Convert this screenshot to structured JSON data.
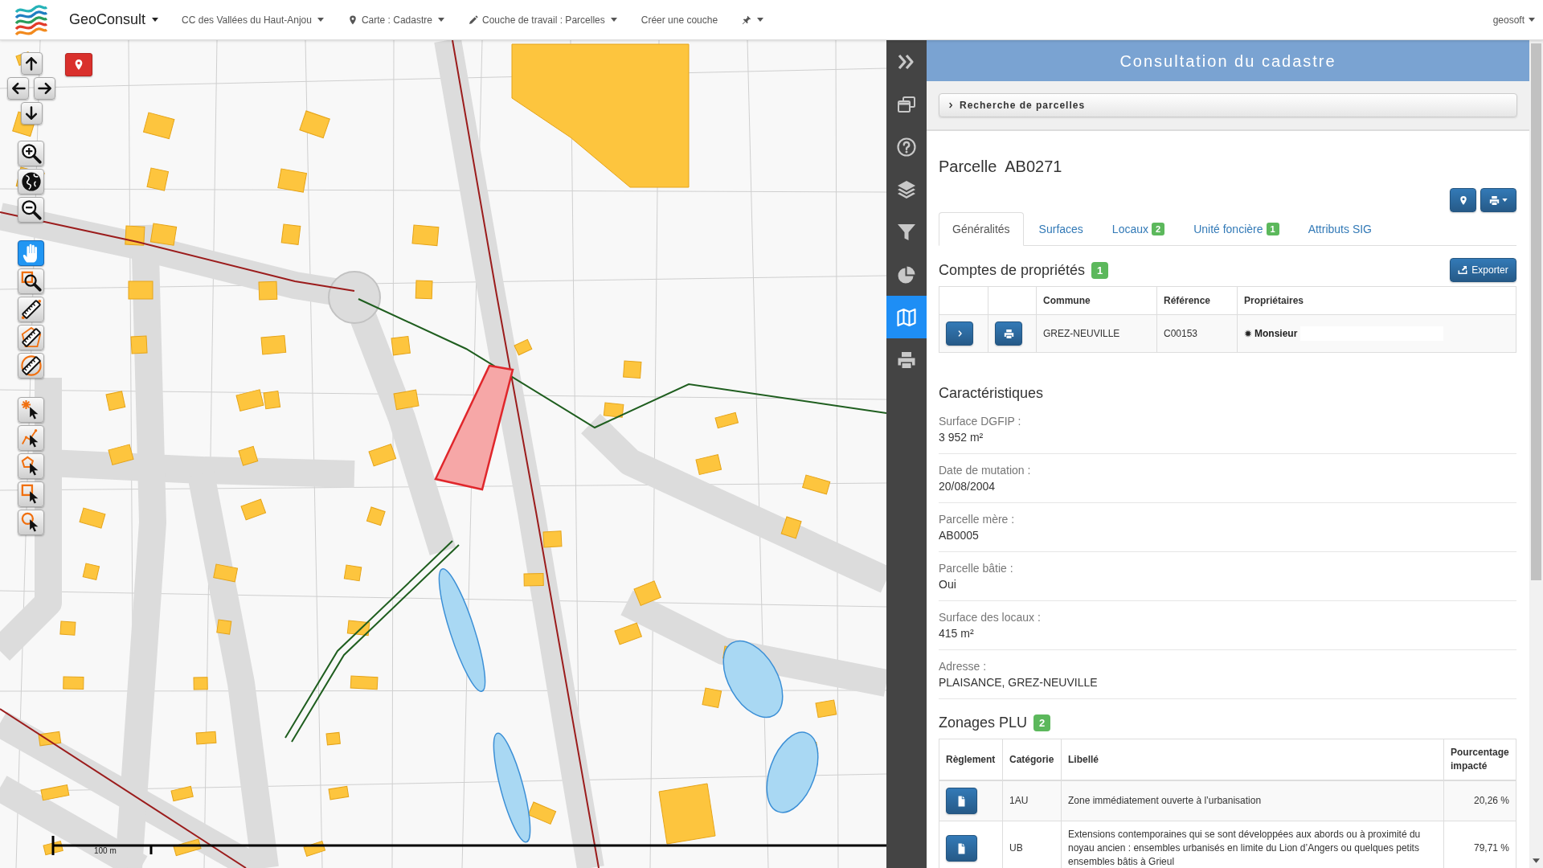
{
  "navbar": {
    "brand": "GeoConsult",
    "menus": [
      {
        "label": "CC des Vallées du Haut-Anjou",
        "kind": "plain",
        "dropdown": true
      },
      {
        "label": "Carte : Cadastre",
        "kind": "map",
        "dropdown": true
      },
      {
        "label": "Couche de travail : Parcelles",
        "kind": "layer",
        "dropdown": true
      },
      {
        "label": "Créer une couche",
        "kind": "plain",
        "dropdown": false
      },
      {
        "kind": "tools",
        "dropdown": true
      }
    ],
    "user": "geosoft"
  },
  "map": {
    "draw_tools": [
      {
        "kind": "pan",
        "selected": true
      },
      {
        "kind": "zoom-box",
        "selected": false
      },
      {
        "kind": "measure-length",
        "selected": false
      },
      {
        "kind": "measure-area",
        "selected": false
      },
      {
        "kind": "measure-radius",
        "selected": false
      }
    ],
    "select_tools": [
      {
        "kind": "point",
        "selected": false
      },
      {
        "kind": "line",
        "selected": false
      },
      {
        "kind": "polygon",
        "selected": false
      },
      {
        "kind": "box",
        "selected": false
      },
      {
        "kind": "circle",
        "selected": false
      }
    ],
    "scale_label": "100 m"
  },
  "sidebar": {
    "items": [
      {
        "kind": "collapse",
        "selected": false
      },
      {
        "kind": "windows",
        "selected": false
      },
      {
        "kind": "help",
        "selected": false
      },
      {
        "kind": "layers",
        "selected": false
      },
      {
        "kind": "filter",
        "selected": false
      },
      {
        "kind": "stats",
        "selected": false
      },
      {
        "kind": "cadastre",
        "selected": true
      },
      {
        "kind": "print",
        "selected": false
      }
    ]
  },
  "panel": {
    "title": "Consultation du cadastre",
    "search_toggle": "Recherche de parcelles",
    "parcel_title": "Parcelle  AB0271",
    "tabs": [
      {
        "label": "Généralités",
        "selected": true
      },
      {
        "label": "Surfaces",
        "selected": false
      },
      {
        "label": "Locaux",
        "badge": "2",
        "selected": false
      },
      {
        "label": "Unité foncière",
        "badge": "1",
        "selected": false
      },
      {
        "label": "Attributs SIG",
        "selected": false
      }
    ],
    "accounts": {
      "title": "Comptes de propriétés",
      "badge": "1",
      "export_button": "Exporter",
      "columns": [
        "Commune",
        "Référence",
        "Propriétaires"
      ],
      "rows": [
        {
          "commune": "GREZ-NEUVILLE",
          "reference": "C00153",
          "owner": "Monsieur",
          "redacted": true
        }
      ]
    },
    "characteristics": {
      "title": "Caractéristiques",
      "fields": [
        {
          "label": "Surface DGFIP :",
          "value": "3 952 m²"
        },
        {
          "label": "Date de mutation :",
          "value": "20/08/2004"
        },
        {
          "label": "Parcelle mère :",
          "value": "AB0005"
        },
        {
          "label": "Parcelle bâtie :",
          "value": "Oui"
        },
        {
          "label": "Surface des locaux :",
          "value": "415 m²"
        },
        {
          "label": "Adresse :",
          "value": "PLAISANCE, GREZ-NEUVILLE"
        }
      ]
    },
    "zoning": {
      "title": "Zonages PLU",
      "badge": "2",
      "columns": [
        "Règlement",
        "Catégorie",
        "Libellé",
        "Pourcentage impacté"
      ],
      "rows": [
        {
          "category": "1AU",
          "label": "Zone immédiatement ouverte à l’urbanisation",
          "percent": "20,26 %"
        },
        {
          "category": "UB",
          "label": "Extensions contemporaines qui se sont développées aux abords ou à proximité du noyau ancien : ensembles urbanisés en limite du Lion d’Angers ou quelques petits ensembles bâtis à Grieul",
          "percent": "79,71 %"
        }
      ]
    }
  }
}
